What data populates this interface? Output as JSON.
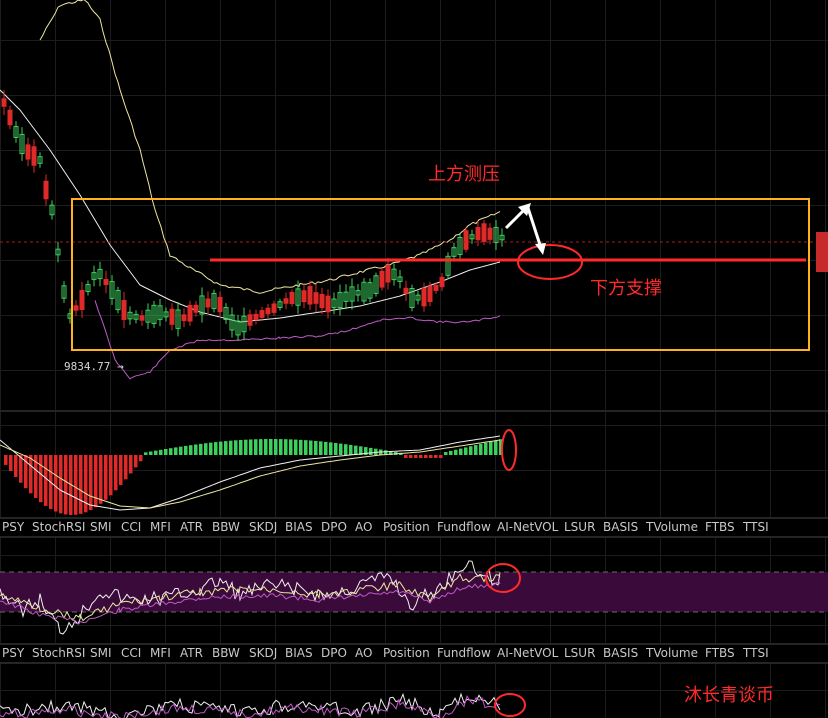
{
  "chart_data": {
    "type": "candlestick",
    "min_price_label": "9834.77",
    "annotations": {
      "resistance_label": "上方测压",
      "support_label": "下方支撑",
      "watermark": "沐长青谈币"
    },
    "colors": {
      "up": "#3ecf5e",
      "down": "#e02a2a",
      "box": "#ffb21a",
      "annotation": "#ff2a2a",
      "arrow": "#ffffff",
      "ma_yellow": "#ede6a0",
      "ma_white": "#f0f0f0",
      "band_lower": "#c05ac8",
      "oscillator_band": "#3a0a3a"
    }
  },
  "indicator_tabs_1": [
    "PSY",
    "StochRSI",
    "SMI",
    "CCI",
    "MFI",
    "ATR",
    "BBW",
    "SKDJ",
    "BIAS",
    "DPO",
    "AO",
    "Position",
    "Fundflow",
    "AI-NetVOL",
    "LSUR",
    "BASIS",
    "TVolume",
    "FTBS",
    "TTSI"
  ],
  "indicator_tabs_2": [
    "PSY",
    "StochRSI",
    "SMI",
    "CCI",
    "MFI",
    "ATR",
    "BBW",
    "SKDJ",
    "BIAS",
    "DPO",
    "AO",
    "Position",
    "Fundflow",
    "AI-NetVOL",
    "LSUR",
    "BASIS",
    "TVolume",
    "FTBS",
    "TTSI"
  ]
}
